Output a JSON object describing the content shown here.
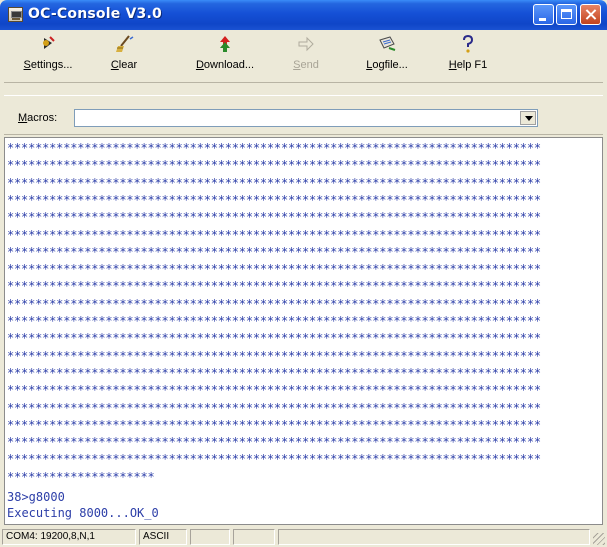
{
  "window": {
    "title": "OC-Console V3.0"
  },
  "toolbar": {
    "settings": {
      "label": "Settings...",
      "icon": "settings-icon"
    },
    "clear": {
      "label": "Clear",
      "icon": "clear-icon"
    },
    "download": {
      "label": "Download...",
      "icon": "download-icon"
    },
    "send": {
      "label": "Send",
      "icon": "send-arrow-icon",
      "disabled": true
    },
    "logfile": {
      "label": "Logfile...",
      "icon": "logfile-icon"
    },
    "help": {
      "label": "Help F1",
      "icon": "help-question-icon"
    }
  },
  "macros": {
    "label": "Macros:",
    "value": ""
  },
  "console": {
    "star_line": "****************************************************************************",
    "star_line_count": 19,
    "partial_star_line": "*********************",
    "prompt_line": "38>g8000",
    "result_line": "Executing 8000...OK_0"
  },
  "status": {
    "port": "COM4: 19200,8,N,1",
    "mode": "ASCII",
    "cell3": "",
    "cell4": ""
  },
  "colors": {
    "console_text": "#2c3ea8",
    "titlebar": "#1550d6",
    "window_bg": "#ece9d8"
  }
}
